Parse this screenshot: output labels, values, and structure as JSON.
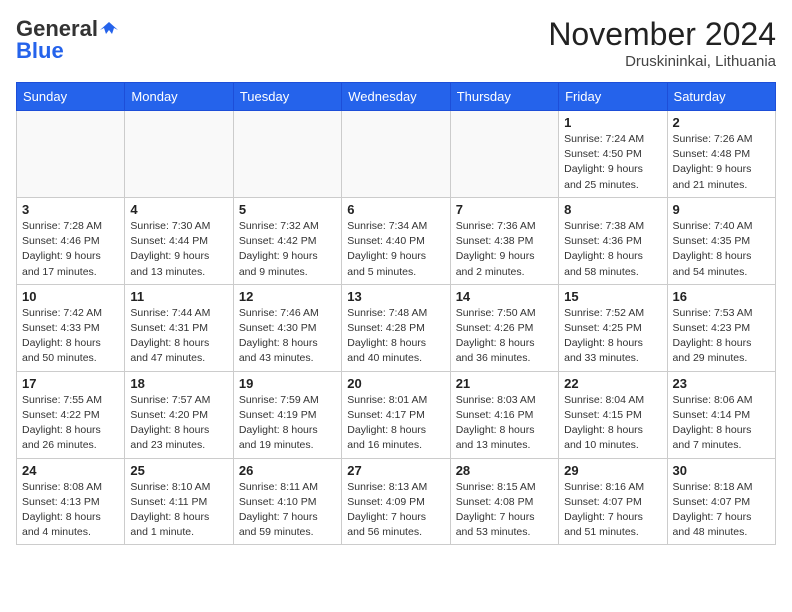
{
  "header": {
    "logo_general": "General",
    "logo_blue": "Blue",
    "month_title": "November 2024",
    "location": "Druskininkai, Lithuania"
  },
  "days_of_week": [
    "Sunday",
    "Monday",
    "Tuesday",
    "Wednesday",
    "Thursday",
    "Friday",
    "Saturday"
  ],
  "weeks": [
    [
      {
        "day": "",
        "info": ""
      },
      {
        "day": "",
        "info": ""
      },
      {
        "day": "",
        "info": ""
      },
      {
        "day": "",
        "info": ""
      },
      {
        "day": "",
        "info": ""
      },
      {
        "day": "1",
        "info": "Sunrise: 7:24 AM\nSunset: 4:50 PM\nDaylight: 9 hours\nand 25 minutes."
      },
      {
        "day": "2",
        "info": "Sunrise: 7:26 AM\nSunset: 4:48 PM\nDaylight: 9 hours\nand 21 minutes."
      }
    ],
    [
      {
        "day": "3",
        "info": "Sunrise: 7:28 AM\nSunset: 4:46 PM\nDaylight: 9 hours\nand 17 minutes."
      },
      {
        "day": "4",
        "info": "Sunrise: 7:30 AM\nSunset: 4:44 PM\nDaylight: 9 hours\nand 13 minutes."
      },
      {
        "day": "5",
        "info": "Sunrise: 7:32 AM\nSunset: 4:42 PM\nDaylight: 9 hours\nand 9 minutes."
      },
      {
        "day": "6",
        "info": "Sunrise: 7:34 AM\nSunset: 4:40 PM\nDaylight: 9 hours\nand 5 minutes."
      },
      {
        "day": "7",
        "info": "Sunrise: 7:36 AM\nSunset: 4:38 PM\nDaylight: 9 hours\nand 2 minutes."
      },
      {
        "day": "8",
        "info": "Sunrise: 7:38 AM\nSunset: 4:36 PM\nDaylight: 8 hours\nand 58 minutes."
      },
      {
        "day": "9",
        "info": "Sunrise: 7:40 AM\nSunset: 4:35 PM\nDaylight: 8 hours\nand 54 minutes."
      }
    ],
    [
      {
        "day": "10",
        "info": "Sunrise: 7:42 AM\nSunset: 4:33 PM\nDaylight: 8 hours\nand 50 minutes."
      },
      {
        "day": "11",
        "info": "Sunrise: 7:44 AM\nSunset: 4:31 PM\nDaylight: 8 hours\nand 47 minutes."
      },
      {
        "day": "12",
        "info": "Sunrise: 7:46 AM\nSunset: 4:30 PM\nDaylight: 8 hours\nand 43 minutes."
      },
      {
        "day": "13",
        "info": "Sunrise: 7:48 AM\nSunset: 4:28 PM\nDaylight: 8 hours\nand 40 minutes."
      },
      {
        "day": "14",
        "info": "Sunrise: 7:50 AM\nSunset: 4:26 PM\nDaylight: 8 hours\nand 36 minutes."
      },
      {
        "day": "15",
        "info": "Sunrise: 7:52 AM\nSunset: 4:25 PM\nDaylight: 8 hours\nand 33 minutes."
      },
      {
        "day": "16",
        "info": "Sunrise: 7:53 AM\nSunset: 4:23 PM\nDaylight: 8 hours\nand 29 minutes."
      }
    ],
    [
      {
        "day": "17",
        "info": "Sunrise: 7:55 AM\nSunset: 4:22 PM\nDaylight: 8 hours\nand 26 minutes."
      },
      {
        "day": "18",
        "info": "Sunrise: 7:57 AM\nSunset: 4:20 PM\nDaylight: 8 hours\nand 23 minutes."
      },
      {
        "day": "19",
        "info": "Sunrise: 7:59 AM\nSunset: 4:19 PM\nDaylight: 8 hours\nand 19 minutes."
      },
      {
        "day": "20",
        "info": "Sunrise: 8:01 AM\nSunset: 4:17 PM\nDaylight: 8 hours\nand 16 minutes."
      },
      {
        "day": "21",
        "info": "Sunrise: 8:03 AM\nSunset: 4:16 PM\nDaylight: 8 hours\nand 13 minutes."
      },
      {
        "day": "22",
        "info": "Sunrise: 8:04 AM\nSunset: 4:15 PM\nDaylight: 8 hours\nand 10 minutes."
      },
      {
        "day": "23",
        "info": "Sunrise: 8:06 AM\nSunset: 4:14 PM\nDaylight: 8 hours\nand 7 minutes."
      }
    ],
    [
      {
        "day": "24",
        "info": "Sunrise: 8:08 AM\nSunset: 4:13 PM\nDaylight: 8 hours\nand 4 minutes."
      },
      {
        "day": "25",
        "info": "Sunrise: 8:10 AM\nSunset: 4:11 PM\nDaylight: 8 hours\nand 1 minute."
      },
      {
        "day": "26",
        "info": "Sunrise: 8:11 AM\nSunset: 4:10 PM\nDaylight: 7 hours\nand 59 minutes."
      },
      {
        "day": "27",
        "info": "Sunrise: 8:13 AM\nSunset: 4:09 PM\nDaylight: 7 hours\nand 56 minutes."
      },
      {
        "day": "28",
        "info": "Sunrise: 8:15 AM\nSunset: 4:08 PM\nDaylight: 7 hours\nand 53 minutes."
      },
      {
        "day": "29",
        "info": "Sunrise: 8:16 AM\nSunset: 4:07 PM\nDaylight: 7 hours\nand 51 minutes."
      },
      {
        "day": "30",
        "info": "Sunrise: 8:18 AM\nSunset: 4:07 PM\nDaylight: 7 hours\nand 48 minutes."
      }
    ]
  ]
}
